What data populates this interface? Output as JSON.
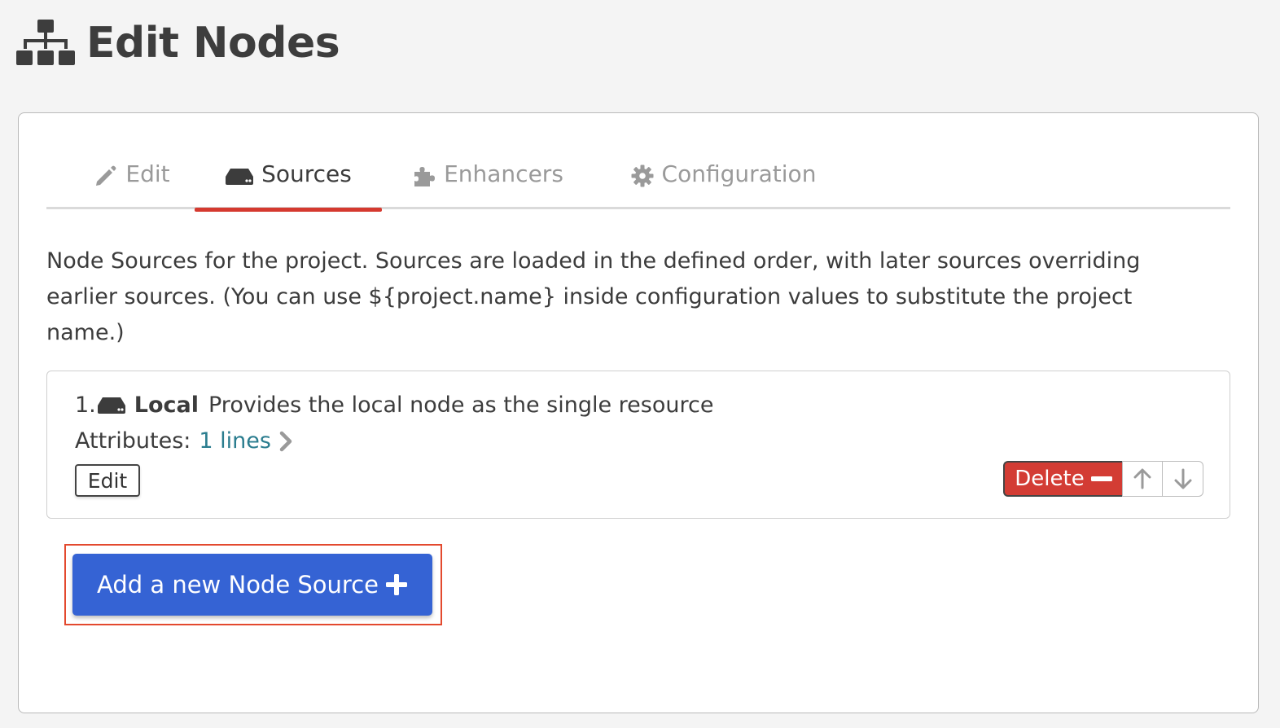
{
  "header": {
    "title": "Edit Nodes",
    "icon": "sitemap-icon"
  },
  "tabs": [
    {
      "label": "Edit",
      "icon": "pencil-icon",
      "active": false
    },
    {
      "label": "Sources",
      "icon": "hdd-icon",
      "active": true
    },
    {
      "label": "Enhancers",
      "icon": "puzzle-icon",
      "active": false
    },
    {
      "label": "Configuration",
      "icon": "gear-icon",
      "active": false
    }
  ],
  "description": "Node Sources for the project. Sources are loaded in the defined order, with later sources overriding earlier sources. (You can use ${project.name} inside configuration values to substitute the project name.)",
  "sources": [
    {
      "index": "1.",
      "icon": "hdd-icon",
      "name": "Local",
      "summary": "Provides the local node as the single resource",
      "attributes_label": "Attributes:",
      "attributes_link": "1 lines",
      "edit_label": "Edit",
      "delete_label": "Delete"
    }
  ],
  "add_button": {
    "label": "Add a new Node Source"
  },
  "colors": {
    "accent_red": "#d5392f",
    "delete_red": "#d33c34",
    "primary_blue": "#3563d4",
    "link_teal": "#2b7d8f",
    "highlight_border": "#e3492e"
  }
}
